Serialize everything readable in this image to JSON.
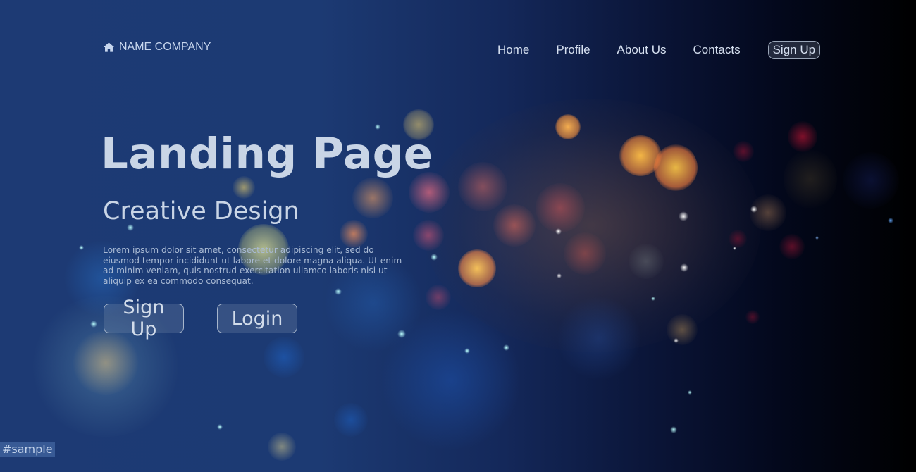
{
  "nav": {
    "brand_icon": "home-icon",
    "brand_name": "NAME COMPANY",
    "links": [
      {
        "label": "Home"
      },
      {
        "label": "Profile"
      },
      {
        "label": "About Us"
      },
      {
        "label": "Contacts"
      }
    ],
    "signup_label": "Sign Up"
  },
  "hero": {
    "title": "Landing Page",
    "subtitle": "Creative Design",
    "body": "Lorem ipsum dolor sit amet, consectetur adipiscing elit, sed do eiusmod tempor incididunt ut labore et dolore magna aliqua. Ut enim ad minim veniam, quis nostrud exercitation ullamco laboris nisi ut aliquip ex ea commodo consequat.",
    "buttons": {
      "signup": "Sign Up",
      "login": "Login"
    }
  },
  "watermark": "#sample",
  "colors": {
    "background_left": "#1d3a74",
    "background_right": "#000000",
    "text_light": "#c9d5e6",
    "bokeh_orange": "#ffb347",
    "bokeh_pink": "#e86a6a"
  }
}
